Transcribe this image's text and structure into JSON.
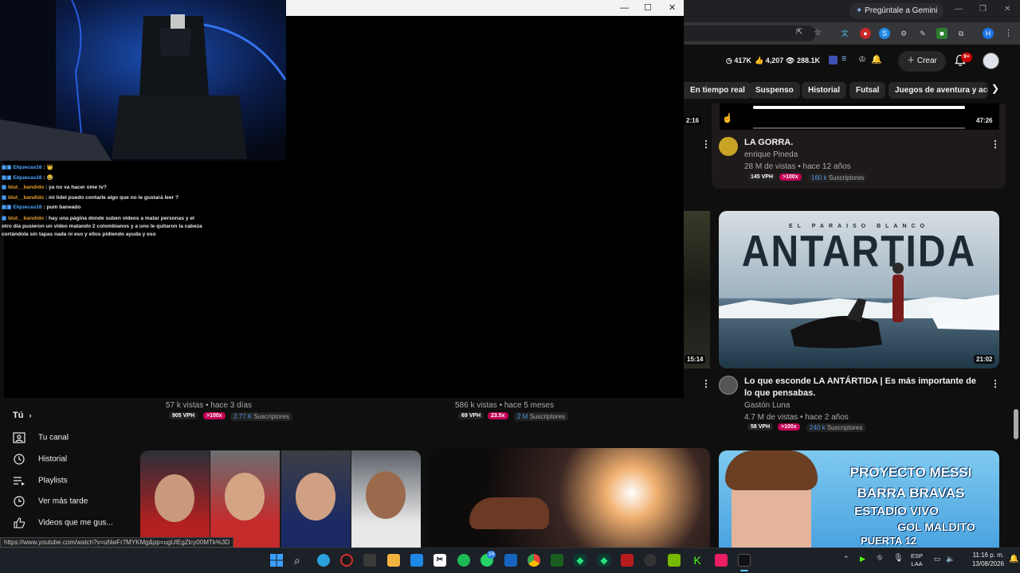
{
  "browser": {
    "gemini_label": "Pregúntale a Gemini",
    "status_url": "https://www.youtube.com/watch?v=uNwFr7MYKMg&pp=ugUlEgZlcy00MTk%3D"
  },
  "yt_header": {
    "stat1": "417K",
    "stat2": "4,207",
    "stat3": "288.1K",
    "create_label": "Crear",
    "notif_badge": "9+"
  },
  "chips": [
    "En tiempo real",
    "Suspenso",
    "Historial",
    "Futsal",
    "Juegos de aventura y acción"
  ],
  "videos": {
    "gorra": {
      "duration": "47:26",
      "left_duration": "2:16",
      "title": "LA GORRA.",
      "channel": "enrique Pineda",
      "meta": "28 M de vistas • hace 12 años",
      "vph": "145 VPH",
      "ratio": ">100x",
      "subs_num": "160 k",
      "subs_label": "Suscriptores"
    },
    "antartida": {
      "thumb_top": "EL PARAISO BLANCO",
      "thumb_title": "ANTARTIDA",
      "duration": "21:02",
      "left_duration": "15:14",
      "title": "Lo que esconde LA ANTÁRTIDA | Es más importante de lo que pensabas.",
      "channel": "Gastón Luna",
      "meta": "4.7 M de vistas • hace 2 años",
      "vph": "58 VPH",
      "ratio": ">100x",
      "subs_num": "240 k",
      "subs_label": "Suscriptores"
    },
    "row_a": {
      "meta": "57 k vistas • hace 3 días",
      "vph": "905 VPH",
      "ratio": ">100x",
      "subs_num": "2.77 K",
      "subs_label": "Suscriptores"
    },
    "row_b": {
      "meta": "586 k vistas • hace 5 meses",
      "vph": "69 VPH",
      "ratio": "23.5x",
      "subs_num": "2 M",
      "subs_label": "Suscriptores"
    },
    "messi": {
      "line1": "PROYECTO MESSI",
      "line2": "BARRA BRAVAS",
      "line3": "ESTADIO VIVO",
      "line4": "GOL MALDITO",
      "line5": "PUERTA 12"
    }
  },
  "sidebar": {
    "section": "Tú",
    "items": [
      "Tu canal",
      "Historial",
      "Playlists",
      "Ver más tarde",
      "Videos que me gus..."
    ]
  },
  "chat": [
    {
      "user": "Elquecas16",
      "text": ": 👑",
      "color": "#4ea8ff"
    },
    {
      "user": "Elquecas16",
      "text": ": 😂",
      "color": "#4ea8ff"
    },
    {
      "user": "blut__bandido",
      "text": ": ya no va hacer ome tv?",
      "color": "#e59e2c"
    },
    {
      "user": "blut__bandido",
      "text": ": mi lidel puedo contarle algo que no le gustará leer ?",
      "color": "#e59e2c"
    },
    {
      "user": "Elquecas16",
      "text": ": pum baneado",
      "color": "#4ea8ff"
    },
    {
      "user": "blut__bandido",
      "text": ": hay una página donde suben videos a matar personas y el otro día pusieron un vídeo matando 2 colombianos y a uno le quitaron la cabeza cortándola sin tapas nada ni eso y ellos pidiendo ayuda y eso",
      "color": "#e59e2c"
    }
  ],
  "taskbar": {
    "lang1": "ESP",
    "lang2": "LAA",
    "time": "11:16 p. m.",
    "date": "13/08/2026",
    "whatsapp_badge": "24"
  }
}
